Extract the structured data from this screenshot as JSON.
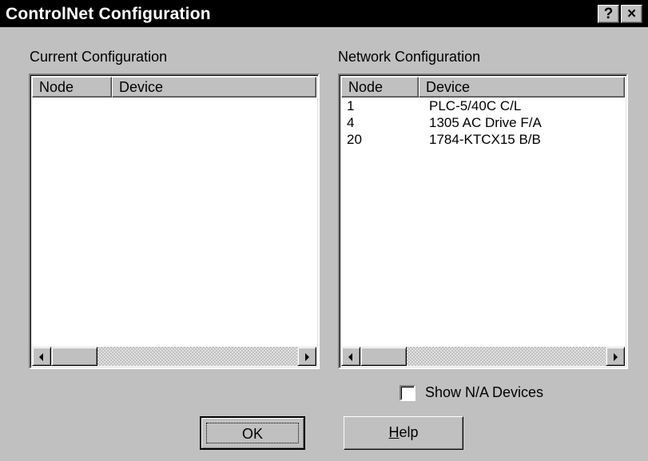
{
  "window": {
    "title": "ControlNet Configuration",
    "help_button": "?",
    "close_button": "×"
  },
  "current_config": {
    "label": "Current Configuration",
    "columns": [
      "Node",
      "Device"
    ],
    "rows": []
  },
  "network_config": {
    "label": "Network Configuration",
    "columns": [
      "Node",
      "Device"
    ],
    "rows": [
      {
        "node": "1",
        "device": "PLC-5/40C C/L"
      },
      {
        "node": "4",
        "device": "1305 AC Drive F/A"
      },
      {
        "node": "20",
        "device": "1784-KTCX15 B/B"
      }
    ]
  },
  "show_na": {
    "label": "Show N/A Devices",
    "checked": false
  },
  "buttons": {
    "ok": "OK",
    "help_mnemonic": "H",
    "help_rest": "elp"
  },
  "icons": {
    "scroll_left": "left-arrow-icon",
    "scroll_right": "right-arrow-icon"
  }
}
